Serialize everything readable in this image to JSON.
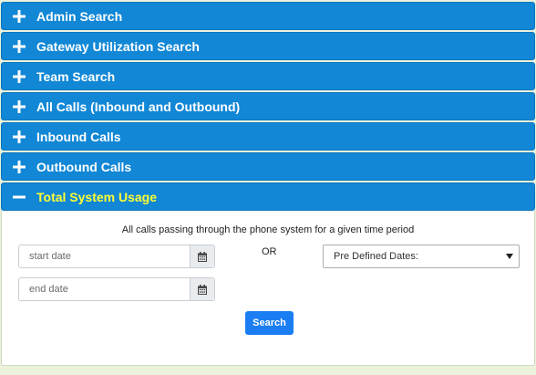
{
  "accordion": {
    "panels": [
      {
        "label": "Admin Search"
      },
      {
        "label": "Gateway Utilization Search"
      },
      {
        "label": "Team Search"
      },
      {
        "label": "All Calls (Inbound and Outbound)"
      },
      {
        "label": "Inbound Calls"
      },
      {
        "label": "Outbound Calls"
      },
      {
        "label": "Total System Usage",
        "expanded": true
      }
    ]
  },
  "total_system_usage": {
    "description": "All calls passing through the phone system for a given time period",
    "start_date": {
      "value": "",
      "placeholder": "start date"
    },
    "end_date": {
      "value": "",
      "placeholder": "end date"
    },
    "or_label": "OR",
    "predefined_dates": {
      "selected": "Pre Defined Dates:"
    },
    "search_button": "Search"
  },
  "colors": {
    "header_bg": "#1187d6",
    "active_label": "#ffff33",
    "search_button": "#1a7ef2",
    "page_bg": "#eaf2dc"
  },
  "icons": {
    "collapsed": "plus-icon",
    "expanded": "minus-icon",
    "date_picker": "calendar-icon",
    "select": "caret-down-icon"
  }
}
